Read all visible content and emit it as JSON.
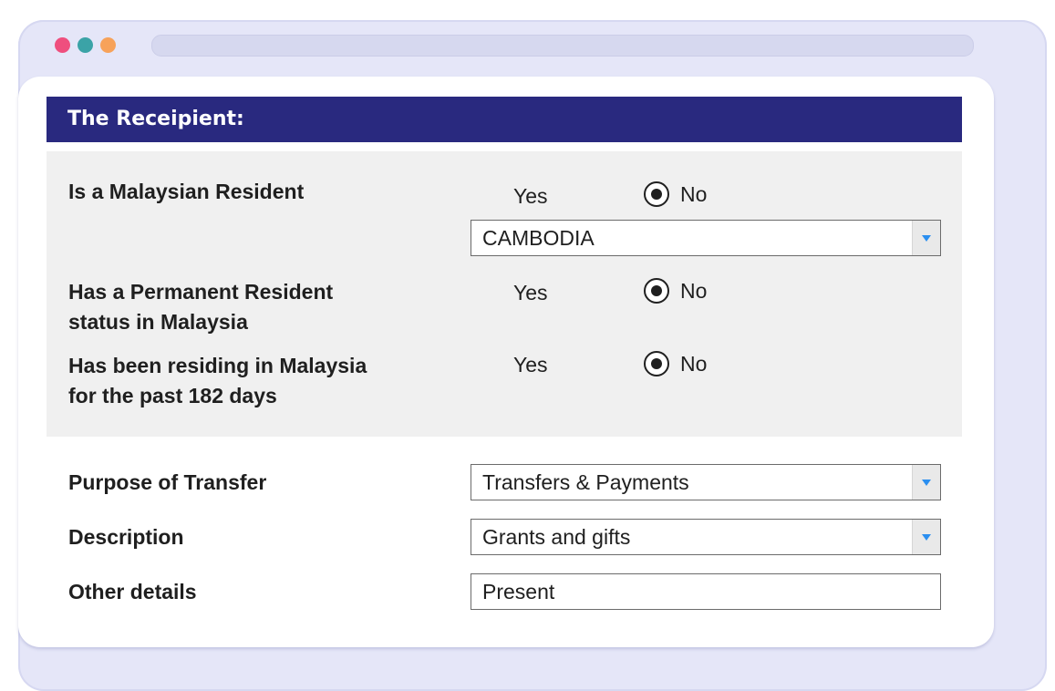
{
  "window": {
    "dots": [
      {
        "name": "close-dot",
        "color": "#ef4f7e"
      },
      {
        "name": "minimize-dot",
        "color": "#3ba3a7"
      },
      {
        "name": "maximize-dot",
        "color": "#f7a25a"
      }
    ]
  },
  "header": {
    "title": "The Receipient:"
  },
  "resident": {
    "label": "Is a Malaysian Resident",
    "yes": "Yes",
    "no": "No",
    "selected": "No",
    "country": "CAMBODIA"
  },
  "permanent": {
    "label_line1": "Has a Permanent Resident",
    "label_line2": "status in Malaysia",
    "yes": "Yes",
    "no": "No",
    "selected": "No"
  },
  "residing": {
    "label_line1": "Has been residing in Malaysia",
    "label_line2": "for the past 182 days",
    "yes": "Yes",
    "no": "No",
    "selected": "No"
  },
  "purpose": {
    "label": "Purpose of Transfer",
    "value": "Transfers & Payments"
  },
  "description": {
    "label": "Description",
    "value": "Grants and gifts"
  },
  "other": {
    "label": "Other details",
    "value": "Present"
  },
  "colors": {
    "header_bg": "#29297f",
    "panel_bg": "#f0f0f0",
    "dropdown_arrow": "#2b8ff0"
  }
}
